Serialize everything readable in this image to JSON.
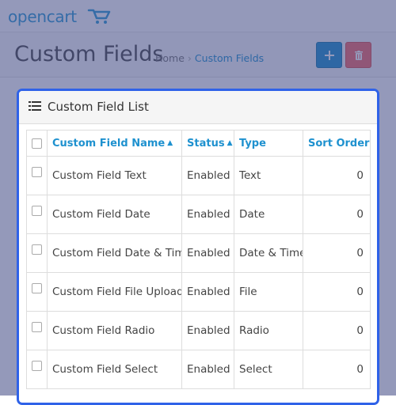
{
  "app": {
    "logo_text": "opencart"
  },
  "page": {
    "title": "Custom Fields"
  },
  "breadcrumb": {
    "home": "Home",
    "separator": "›",
    "current": "Custom Fields"
  },
  "actions": {
    "add_icon": "plus-icon",
    "delete_icon": "trash-icon"
  },
  "panel": {
    "title": "Custom Field List",
    "icon": "list-icon"
  },
  "table": {
    "headers": {
      "name": "Custom Field Name",
      "status": "Status",
      "type": "Type",
      "sort_order": "Sort Order",
      "sort_caret": "^"
    },
    "rows": [
      {
        "name": "Custom Field Text",
        "status": "Enabled",
        "type": "Text",
        "sort_order": "0"
      },
      {
        "name": "Custom Field Date",
        "status": "Enabled",
        "type": "Date",
        "sort_order": "0"
      },
      {
        "name": "Custom Field Date & Time",
        "status": "Enabled",
        "type": "Date & Time",
        "sort_order": "0"
      },
      {
        "name": "Custom Field File Upload",
        "status": "Enabled",
        "type": "File",
        "sort_order": "0"
      },
      {
        "name": "Custom Field Radio",
        "status": "Enabled",
        "type": "Radio",
        "sort_order": "0"
      },
      {
        "name": "Custom Field Select",
        "status": "Enabled",
        "type": "Select",
        "sort_order": "0"
      }
    ]
  },
  "colors": {
    "brand": "#2d9bd6",
    "primary": "#1e91cf",
    "danger": "#f56b6b",
    "highlight_border": "#2f62e8",
    "overlay": "#3c4682"
  }
}
